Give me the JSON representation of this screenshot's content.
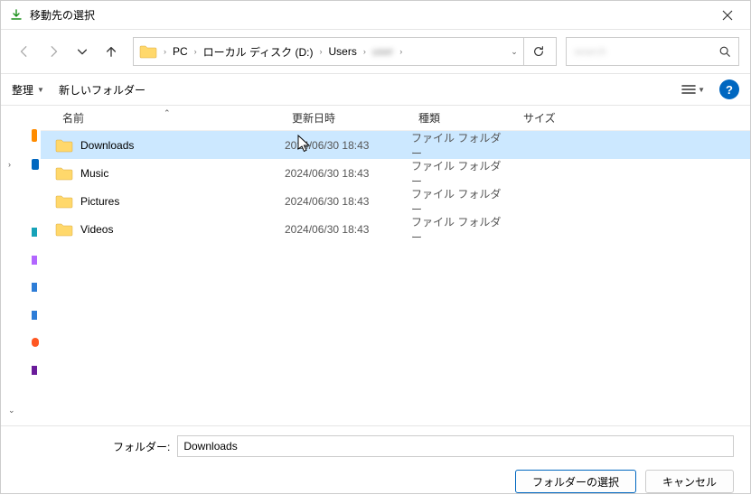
{
  "title": "移動先の選択",
  "breadcrumbs": [
    "PC",
    "ローカル ディスク (D:)",
    "Users",
    ""
  ],
  "search_placeholder": "",
  "toolbar": {
    "organize": "整理",
    "new_folder": "新しいフォルダー"
  },
  "columns": {
    "name": "名前",
    "date": "更新日時",
    "type": "種類",
    "size": "サイズ"
  },
  "rows": [
    {
      "name": "Downloads",
      "date": "2024/06/30 18:43",
      "type": "ファイル フォルダー",
      "selected": true
    },
    {
      "name": "Music",
      "date": "2024/06/30 18:43",
      "type": "ファイル フォルダー",
      "selected": false
    },
    {
      "name": "Pictures",
      "date": "2024/06/30 18:43",
      "type": "ファイル フォルダー",
      "selected": false
    },
    {
      "name": "Videos",
      "date": "2024/06/30 18:43",
      "type": "ファイル フォルダー",
      "selected": false
    }
  ],
  "folder_label": "フォルダー:",
  "folder_value": "Downloads",
  "buttons": {
    "select": "フォルダーの選択",
    "cancel": "キャンセル"
  }
}
